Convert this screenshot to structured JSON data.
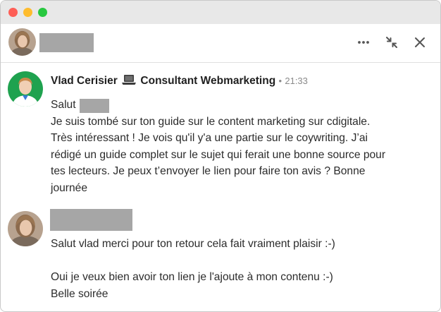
{
  "colors": {
    "window_border": "#c9c9c9",
    "titlebar": "#e8e8e8",
    "close_dot": "#fe5f57",
    "minimize_dot": "#febc2e",
    "zoom_dot": "#28c840",
    "redaction": "#a6a6a6",
    "timestamp": "#8a8a8a",
    "avatar_green_bg": "#1fa24f"
  },
  "header": {
    "actions": [
      {
        "icon": "more-icon"
      },
      {
        "icon": "collapse-icon"
      },
      {
        "icon": "close-icon"
      }
    ]
  },
  "messages": [
    {
      "sender": {
        "name": "Vlad Cerisier",
        "icon": "laptop-icon",
        "headline": "Consultant Webmarketing",
        "separator": "•",
        "time": "21:33"
      },
      "greeting": "Salut",
      "lines": [
        "Je suis tombé sur ton guide sur le content marketing sur cdigitale.",
        "Très intéressant ! Je vois qu'il y'a une partie sur le coywriting. J’ai",
        "rédigé un guide complet sur le sujet qui ferait une bonne source pour",
        "tes lecteurs. Je peux t’envoyer le lien pour faire ton avis ? Bonne",
        "journée"
      ]
    },
    {
      "lines": [
        "Salut vlad merci pour ton retour cela fait vraiment plaisir :-)",
        "",
        "Oui je veux bien avoir ton lien je l'ajoute à mon contenu :-)",
        "Belle soirée"
      ]
    }
  ]
}
